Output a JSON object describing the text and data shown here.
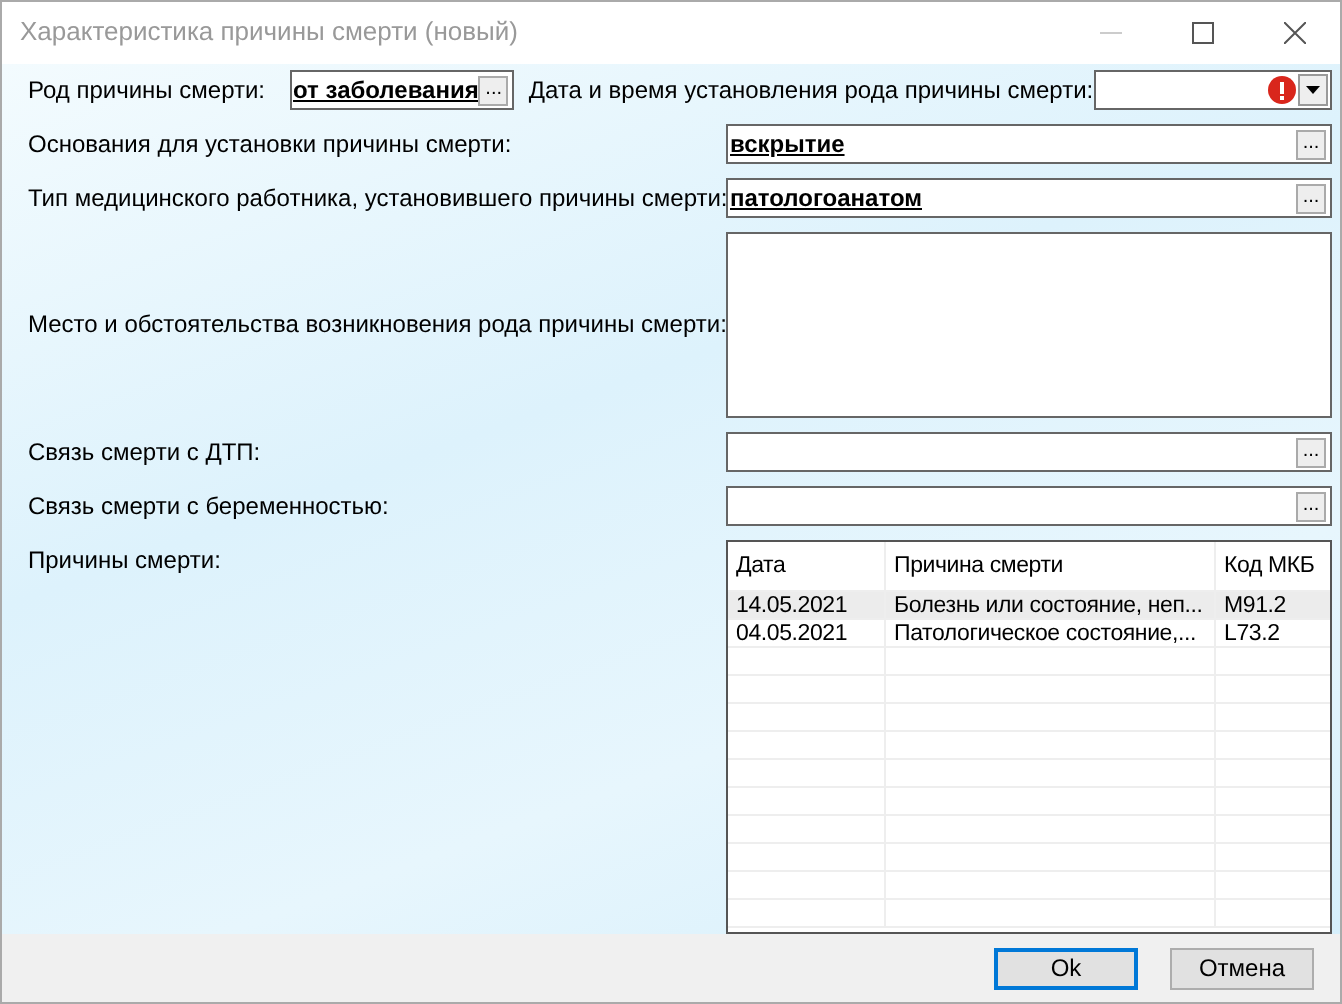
{
  "window": {
    "title": "Характеристика причины смерти (новый)"
  },
  "form": {
    "cause_kind": {
      "label": "Род причины смерти:",
      "value": "от заболевания",
      "button": "..."
    },
    "established_at": {
      "label": "Дата и время установления рода причины смерти:",
      "invalid": true
    },
    "fields": [
      {
        "kind": "lookup",
        "label": "Основания для установки причины смерти:",
        "value": "вскрытие",
        "button": "..."
      },
      {
        "kind": "lookup",
        "label": "Тип медицинского работника, установившего причины смерти:",
        "value": "патологоанатом",
        "button": "..."
      },
      {
        "kind": "memo",
        "label": "Место и обстоятельства возникновения рода причины смерти:"
      },
      {
        "kind": "lookup",
        "label": "Связь смерти с ДТП:",
        "button": "..."
      },
      {
        "kind": "lookup",
        "label": "Связь смерти с беременностью:",
        "button": "..."
      }
    ],
    "causes": {
      "label": "Причины смерти:",
      "columns": [
        "Дата",
        "Причина смерти",
        "Код МКБ"
      ],
      "rows": [
        {
          "cells": [
            "14.05.2021",
            "Болезнь или состояние, неп...",
            "M91.2"
          ],
          "selected": true
        },
        {
          "cells": [
            "04.05.2021",
            "Патологическое состояние,...",
            "L73.2"
          ],
          "selected": false
        }
      ]
    }
  },
  "buttons": [
    {
      "label": "Ok",
      "default": true
    },
    {
      "label": "Отмена",
      "default": false
    }
  ]
}
